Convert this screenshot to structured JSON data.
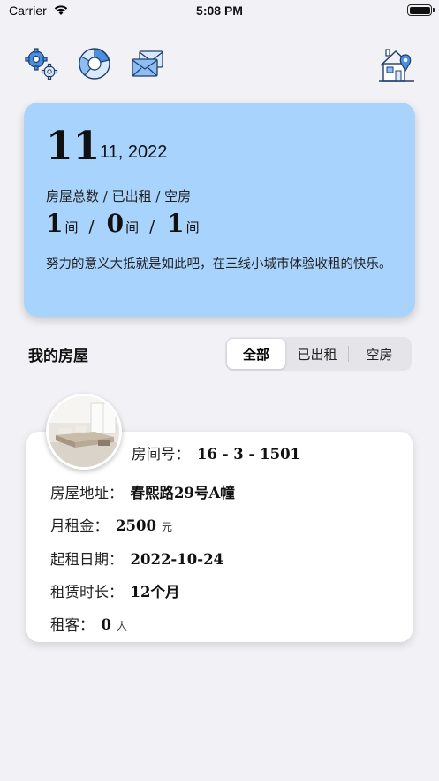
{
  "status_bar": {
    "carrier": "Carrier",
    "time": "5:08 PM"
  },
  "toolbar": {
    "settings_icon": "settings-gears-icon",
    "stats_icon": "pie-chart-icon",
    "messages_icon": "envelope-icon",
    "house_location_icon": "house-location-icon"
  },
  "summary": {
    "day": "11",
    "month_year": "11, 2022",
    "stats_label": "房屋总数 / 已出租 / 空房",
    "total": "1",
    "rented": "0",
    "vacant": "1",
    "unit": "间",
    "separator": "/",
    "motto": "努力的意义大抵就是如此吧，在三线小城市体验收租的快乐。",
    "background_color": "#a8d3fc"
  },
  "section": {
    "title": "我的房屋",
    "tabs": [
      "全部",
      "已出租",
      "空房"
    ],
    "selected_tab": "全部"
  },
  "house": {
    "room_label": "房间号：",
    "room_value": "16 - 3 - 1501",
    "address_label": "房屋地址：",
    "address_value": "春熙路29号A幢",
    "rent_label": "月租金：",
    "rent_value": "2500",
    "rent_unit": "元",
    "start_label": "起租日期：",
    "start_value": "2022-10-24",
    "duration_label": "租赁时长：",
    "duration_value": "12个月",
    "tenant_label": "租客：",
    "tenant_value": "0",
    "tenant_unit": "人"
  }
}
